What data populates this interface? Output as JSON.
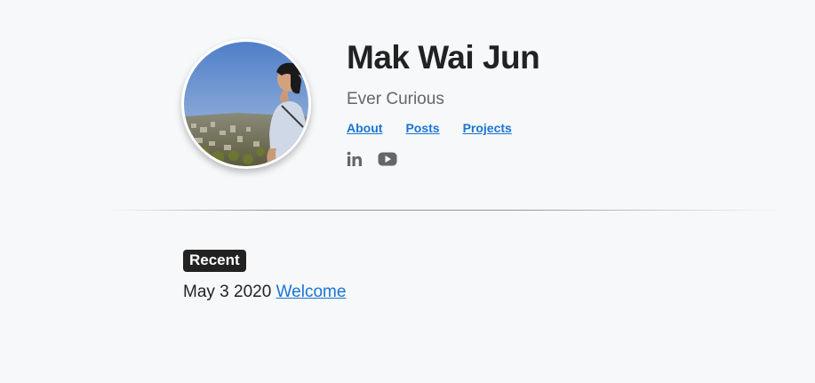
{
  "profile": {
    "name": "Mak Wai Jun",
    "tagline": "Ever Curious"
  },
  "nav": {
    "items": [
      {
        "label": "About"
      },
      {
        "label": "Posts"
      },
      {
        "label": "Projects"
      }
    ]
  },
  "social": {
    "icons": [
      "linkedin-icon",
      "youtube-icon"
    ],
    "icon_color": "#666666"
  },
  "recent": {
    "heading": "Recent",
    "posts": [
      {
        "date": "May 3 2020",
        "title": "Welcome"
      }
    ]
  },
  "colors": {
    "background": "#f6f8fa",
    "link": "#1a75d2",
    "text": "#222222",
    "muted": "#666666"
  }
}
